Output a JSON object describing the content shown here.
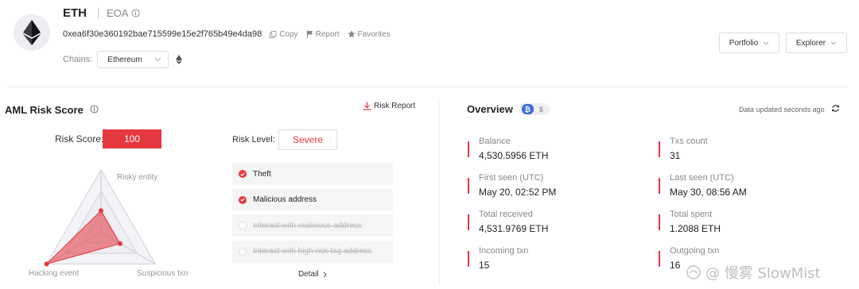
{
  "header": {
    "name": "ETH",
    "account_type": "EOA",
    "address": "0xea6f30e360192bae715599e15e2f765b49e4da98",
    "actions": {
      "copy": "Copy",
      "report": "Report",
      "favorites": "Favorites"
    },
    "chains_label": "Chains:",
    "chain_selected": "Ethereum",
    "buttons": {
      "portfolio": "Portfolio",
      "explorer": "Explorer"
    }
  },
  "aml": {
    "title": "AML Risk Score",
    "risk_report": "Risk Report",
    "score_label": "Risk Score:",
    "score": "100",
    "level_label": "Risk Level:",
    "level": "Severe",
    "radar": {
      "axes": [
        "Risky entity",
        "Hacking event",
        "Suspicious txn"
      ],
      "values": [
        0.35,
        1.0,
        0.35
      ]
    },
    "risk_items": [
      {
        "label": "Theft",
        "active": true
      },
      {
        "label": "Malicious address",
        "active": true
      },
      {
        "label": "Interact with malicious address",
        "active": false
      },
      {
        "label": "Interact with high-risk tag address",
        "active": false
      }
    ],
    "detail": "Detail"
  },
  "overview": {
    "title": "Overview",
    "coin_badges": [
      "₿",
      "$"
    ],
    "updated": "Data updated seconds ago",
    "stats": [
      {
        "label": "Balance",
        "value": "4,530.5956 ETH"
      },
      {
        "label": "Txs count",
        "value": "31"
      },
      {
        "label": "First seen (UTC)",
        "value": "May 20, 02:52 PM"
      },
      {
        "label": "Last seen (UTC)",
        "value": "May 30, 08:56 AM"
      },
      {
        "label": "Total received",
        "value": "4,531.9769 ETH"
      },
      {
        "label": "Total spent",
        "value": "1.2088 ETH"
      },
      {
        "label": "Incoming txn",
        "value": "15"
      },
      {
        "label": "Outgoing txn",
        "value": "16"
      }
    ]
  },
  "watermark": "@ 慢雾 SlowMist",
  "colors": {
    "accent_red": "#e5383f",
    "btc_blue": "#3f6ad8"
  }
}
